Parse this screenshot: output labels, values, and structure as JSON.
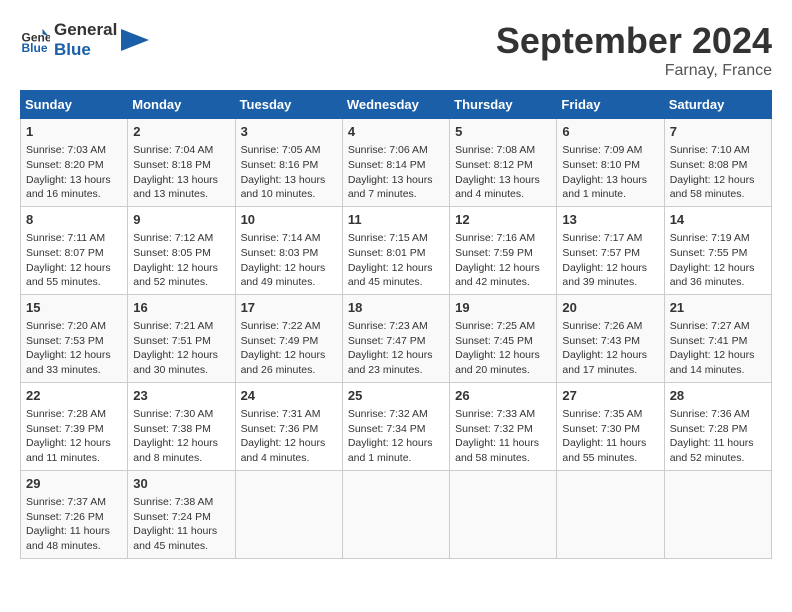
{
  "header": {
    "logo_line1": "General",
    "logo_line2": "Blue",
    "month_year": "September 2024",
    "location": "Farnay, France"
  },
  "days_of_week": [
    "Sunday",
    "Monday",
    "Tuesday",
    "Wednesday",
    "Thursday",
    "Friday",
    "Saturday"
  ],
  "weeks": [
    [
      {
        "day": "1",
        "info": "Sunrise: 7:03 AM\nSunset: 8:20 PM\nDaylight: 13 hours\nand 16 minutes."
      },
      {
        "day": "2",
        "info": "Sunrise: 7:04 AM\nSunset: 8:18 PM\nDaylight: 13 hours\nand 13 minutes."
      },
      {
        "day": "3",
        "info": "Sunrise: 7:05 AM\nSunset: 8:16 PM\nDaylight: 13 hours\nand 10 minutes."
      },
      {
        "day": "4",
        "info": "Sunrise: 7:06 AM\nSunset: 8:14 PM\nDaylight: 13 hours\nand 7 minutes."
      },
      {
        "day": "5",
        "info": "Sunrise: 7:08 AM\nSunset: 8:12 PM\nDaylight: 13 hours\nand 4 minutes."
      },
      {
        "day": "6",
        "info": "Sunrise: 7:09 AM\nSunset: 8:10 PM\nDaylight: 13 hours\nand 1 minute."
      },
      {
        "day": "7",
        "info": "Sunrise: 7:10 AM\nSunset: 8:08 PM\nDaylight: 12 hours\nand 58 minutes."
      }
    ],
    [
      {
        "day": "8",
        "info": "Sunrise: 7:11 AM\nSunset: 8:07 PM\nDaylight: 12 hours\nand 55 minutes."
      },
      {
        "day": "9",
        "info": "Sunrise: 7:12 AM\nSunset: 8:05 PM\nDaylight: 12 hours\nand 52 minutes."
      },
      {
        "day": "10",
        "info": "Sunrise: 7:14 AM\nSunset: 8:03 PM\nDaylight: 12 hours\nand 49 minutes."
      },
      {
        "day": "11",
        "info": "Sunrise: 7:15 AM\nSunset: 8:01 PM\nDaylight: 12 hours\nand 45 minutes."
      },
      {
        "day": "12",
        "info": "Sunrise: 7:16 AM\nSunset: 7:59 PM\nDaylight: 12 hours\nand 42 minutes."
      },
      {
        "day": "13",
        "info": "Sunrise: 7:17 AM\nSunset: 7:57 PM\nDaylight: 12 hours\nand 39 minutes."
      },
      {
        "day": "14",
        "info": "Sunrise: 7:19 AM\nSunset: 7:55 PM\nDaylight: 12 hours\nand 36 minutes."
      }
    ],
    [
      {
        "day": "15",
        "info": "Sunrise: 7:20 AM\nSunset: 7:53 PM\nDaylight: 12 hours\nand 33 minutes."
      },
      {
        "day": "16",
        "info": "Sunrise: 7:21 AM\nSunset: 7:51 PM\nDaylight: 12 hours\nand 30 minutes."
      },
      {
        "day": "17",
        "info": "Sunrise: 7:22 AM\nSunset: 7:49 PM\nDaylight: 12 hours\nand 26 minutes."
      },
      {
        "day": "18",
        "info": "Sunrise: 7:23 AM\nSunset: 7:47 PM\nDaylight: 12 hours\nand 23 minutes."
      },
      {
        "day": "19",
        "info": "Sunrise: 7:25 AM\nSunset: 7:45 PM\nDaylight: 12 hours\nand 20 minutes."
      },
      {
        "day": "20",
        "info": "Sunrise: 7:26 AM\nSunset: 7:43 PM\nDaylight: 12 hours\nand 17 minutes."
      },
      {
        "day": "21",
        "info": "Sunrise: 7:27 AM\nSunset: 7:41 PM\nDaylight: 12 hours\nand 14 minutes."
      }
    ],
    [
      {
        "day": "22",
        "info": "Sunrise: 7:28 AM\nSunset: 7:39 PM\nDaylight: 12 hours\nand 11 minutes."
      },
      {
        "day": "23",
        "info": "Sunrise: 7:30 AM\nSunset: 7:38 PM\nDaylight: 12 hours\nand 8 minutes."
      },
      {
        "day": "24",
        "info": "Sunrise: 7:31 AM\nSunset: 7:36 PM\nDaylight: 12 hours\nand 4 minutes."
      },
      {
        "day": "25",
        "info": "Sunrise: 7:32 AM\nSunset: 7:34 PM\nDaylight: 12 hours\nand 1 minute."
      },
      {
        "day": "26",
        "info": "Sunrise: 7:33 AM\nSunset: 7:32 PM\nDaylight: 11 hours\nand 58 minutes."
      },
      {
        "day": "27",
        "info": "Sunrise: 7:35 AM\nSunset: 7:30 PM\nDaylight: 11 hours\nand 55 minutes."
      },
      {
        "day": "28",
        "info": "Sunrise: 7:36 AM\nSunset: 7:28 PM\nDaylight: 11 hours\nand 52 minutes."
      }
    ],
    [
      {
        "day": "29",
        "info": "Sunrise: 7:37 AM\nSunset: 7:26 PM\nDaylight: 11 hours\nand 48 minutes."
      },
      {
        "day": "30",
        "info": "Sunrise: 7:38 AM\nSunset: 7:24 PM\nDaylight: 11 hours\nand 45 minutes."
      },
      {
        "day": "",
        "info": ""
      },
      {
        "day": "",
        "info": ""
      },
      {
        "day": "",
        "info": ""
      },
      {
        "day": "",
        "info": ""
      },
      {
        "day": "",
        "info": ""
      }
    ]
  ]
}
